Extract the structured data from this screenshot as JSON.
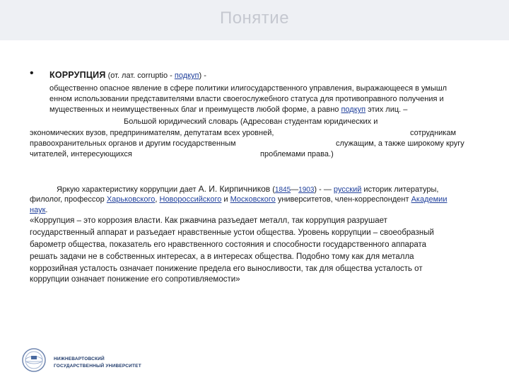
{
  "title": "Понятие",
  "definition": {
    "bullet": "•",
    "term": "КОРРУПЦИЯ",
    "etym_pre": " (от. лат. corruptio - ",
    "etym_link": "подкуп",
    "etym_post": ") -",
    "line1": "общественно опасное явление в сфере политики илигосударственного управления, выражающееся в умышл",
    "line2": "енном использовании представителями власти своегослужебного статуса для противоправного получения и",
    "line3_pre": "мущественных и неимущественных благ и преимуществ любой форме, а равно ",
    "line3_link": "подкуп",
    "line3_post": " этих лиц.  –"
  },
  "source": {
    "line1": "Большой юридический словарь (Адресован студентам юридических и",
    "line2a": "экономических вузов, предпринимателям, депутатам всех уровней,",
    "line2b": "сотрудникам",
    "line3a": "правоохранительных органов и другим государственным",
    "line3b": "служащим, а также широкому кругу",
    "line4a": "читателей, интересующихся",
    "line4b": "проблемами права.)"
  },
  "kirpichnikov": {
    "l1_pre": "Яркую характеристику коррупции дает ",
    "name": "А. И. Кирпичников",
    "l1_paren_open": " (",
    "year1": "1845",
    "dash": "—",
    "year2": "1903",
    "l1_paren_close": ") -  — ",
    "link_russian": "русский",
    "l1_post": " историк литературы,",
    "l2_pre": "филолог, профессор ",
    "link_kharkov": "Харьковского",
    "sep1": ", ",
    "link_novoross": "Новороссийского",
    "and": " и ",
    "link_moscow": "Московского",
    "l2_post": " университетов, член-корреспондент ",
    "link_academy1": "Академии",
    "link_academy2": "наук",
    "l3_post": "."
  },
  "quote": [
    "«Коррупция – это коррозия власти. Как ржавчина разъедает металл, так коррупция разрушает",
    "государственный аппарат и разъедает нравственные устои общества. Уровень коррупции – своеобразный",
    "барометр общества, показатель его нравственного состояния и способности государственного аппарата",
    "решать задачи не в собственных интересах, а в интересах общества. Подобно тому как для металла",
    "коррозийная усталость означает понижение предела его выносливости, так для общества усталость от",
    "коррупции означает понижение его сопротивляемости»"
  ],
  "logo": {
    "line1": "НИЖНЕВАРТОВСКИЙ",
    "line2": "ГОСУДАРСТВЕННЫЙ  УНИВЕРСИТЕТ"
  }
}
